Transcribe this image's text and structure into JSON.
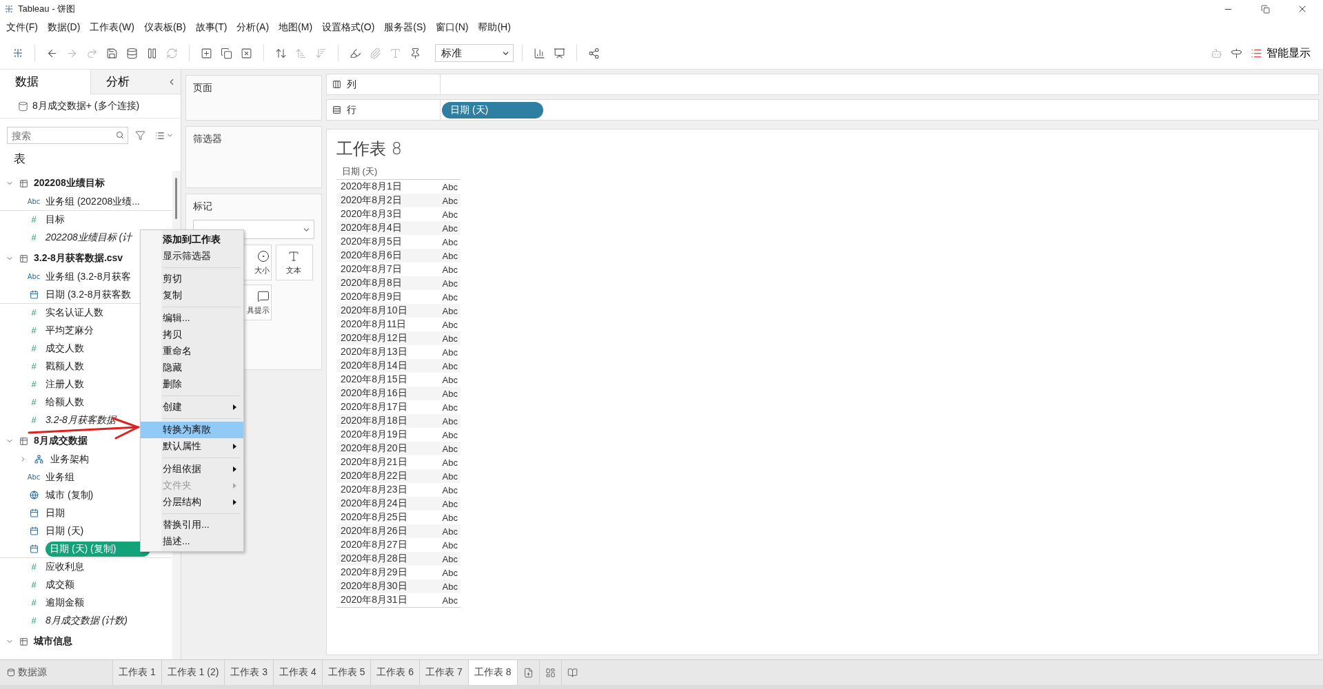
{
  "window": {
    "title": "Tableau - 饼图"
  },
  "menu_bar": [
    "文件(F)",
    "数据(D)",
    "工作表(W)",
    "仪表板(B)",
    "故事(T)",
    "分析(A)",
    "地图(M)",
    "设置格式(O)",
    "服务器(S)",
    "窗口(N)",
    "帮助(H)"
  ],
  "toolbar": {
    "fit": "标准",
    "show_me": "智能显示"
  },
  "data_pane": {
    "tabs": [
      {
        "label": "数据",
        "selected": true
      },
      {
        "label": "分析",
        "selected": false
      }
    ],
    "data_source": "8月成交数据+ (多个连接)",
    "search": {
      "placeholder": "搜索"
    },
    "section_title": "表",
    "tables": [
      {
        "name": "202208业绩目标",
        "expanded": true,
        "fields": [
          {
            "kind": "text",
            "icon": "Abc",
            "name": "业务组 (202208业绩...",
            "italic": false,
            "selected": false
          },
          {
            "kind": "number",
            "icon": "#",
            "name": "目标",
            "italic": false,
            "selected": false
          },
          {
            "kind": "number",
            "icon": "#",
            "name": "202208业绩目标 (计",
            "italic": true,
            "selected": false
          }
        ]
      },
      {
        "name": "3.2-8月获客数据.csv",
        "expanded": true,
        "fields": [
          {
            "kind": "text",
            "icon": "Abc",
            "name": "业务组 (3.2-8月获客",
            "italic": false,
            "selected": false
          },
          {
            "kind": "date",
            "name": "日期 (3.2-8月获客数",
            "italic": false,
            "selected": false
          },
          {
            "kind": "number",
            "icon": "#",
            "name": "实名认证人数",
            "italic": false,
            "selected": false
          },
          {
            "kind": "number",
            "icon": "#",
            "name": "平均芝麻分",
            "italic": false,
            "selected": false
          },
          {
            "kind": "number",
            "icon": "#",
            "name": "成交人数",
            "italic": false,
            "selected": false
          },
          {
            "kind": "number",
            "icon": "#",
            "name": "戳额人数",
            "italic": false,
            "selected": false
          },
          {
            "kind": "number",
            "icon": "#",
            "name": "注册人数",
            "italic": false,
            "selected": false
          },
          {
            "kind": "number",
            "icon": "#",
            "name": "给额人数",
            "italic": false,
            "selected": false
          },
          {
            "kind": "number",
            "icon": "#",
            "name": "3.2-8月获客数据",
            "italic": true,
            "selected": false
          }
        ]
      },
      {
        "name": "8月成交数据",
        "expanded": true,
        "fields": [
          {
            "kind": "hierarchy",
            "name": "业务架构",
            "italic": false,
            "selected": false,
            "expanded": false
          },
          {
            "kind": "text",
            "icon": "Abc",
            "name": "业务组",
            "italic": false,
            "selected": false
          },
          {
            "kind": "geo-calc",
            "name": "城市 (复制)",
            "italic": false,
            "selected": false
          },
          {
            "kind": "date",
            "name": "日期",
            "italic": false,
            "selected": false
          },
          {
            "kind": "date-calc",
            "name": "日期 (天)",
            "italic": false,
            "selected": false
          },
          {
            "kind": "date-calc",
            "name": "日期 (天) (复制)",
            "italic": false,
            "selected": true
          },
          {
            "kind": "number",
            "icon": "#",
            "name": "应收利息",
            "italic": false,
            "selected": false
          },
          {
            "kind": "number",
            "icon": "#",
            "name": "成交额",
            "italic": false,
            "selected": false
          },
          {
            "kind": "number",
            "icon": "#",
            "name": "逾期金额",
            "italic": false,
            "selected": false
          },
          {
            "kind": "number",
            "icon": "#",
            "name": "8月成交数据 (计数)",
            "italic": true,
            "selected": false
          }
        ]
      },
      {
        "name": "城市信息",
        "expanded": true
      }
    ]
  },
  "cards": {
    "pages": "页面",
    "filters": "筛选器",
    "marks": {
      "title": "标记",
      "buttons": [
        {
          "kind": "size",
          "label": "大小"
        },
        {
          "kind": "text",
          "label": "文本"
        },
        {
          "kind": "tooltip",
          "label": "具提示"
        }
      ]
    }
  },
  "shelves": {
    "columns": {
      "label": "列"
    },
    "rows": {
      "label": "行",
      "pills": [
        {
          "label": "日期 (天)"
        }
      ]
    }
  },
  "worksheet": {
    "title": "工作表 8",
    "header": "日期 (天)",
    "rows": [
      {
        "date": "2020年8月1日",
        "mark": "Abc"
      },
      {
        "date": "2020年8月2日",
        "mark": "Abc"
      },
      {
        "date": "2020年8月3日",
        "mark": "Abc"
      },
      {
        "date": "2020年8月4日",
        "mark": "Abc"
      },
      {
        "date": "2020年8月5日",
        "mark": "Abc"
      },
      {
        "date": "2020年8月6日",
        "mark": "Abc"
      },
      {
        "date": "2020年8月7日",
        "mark": "Abc"
      },
      {
        "date": "2020年8月8日",
        "mark": "Abc"
      },
      {
        "date": "2020年8月9日",
        "mark": "Abc"
      },
      {
        "date": "2020年8月10日",
        "mark": "Abc"
      },
      {
        "date": "2020年8月11日",
        "mark": "Abc"
      },
      {
        "date": "2020年8月12日",
        "mark": "Abc"
      },
      {
        "date": "2020年8月13日",
        "mark": "Abc"
      },
      {
        "date": "2020年8月14日",
        "mark": "Abc"
      },
      {
        "date": "2020年8月15日",
        "mark": "Abc"
      },
      {
        "date": "2020年8月16日",
        "mark": "Abc"
      },
      {
        "date": "2020年8月17日",
        "mark": "Abc"
      },
      {
        "date": "2020年8月18日",
        "mark": "Abc"
      },
      {
        "date": "2020年8月19日",
        "mark": "Abc"
      },
      {
        "date": "2020年8月20日",
        "mark": "Abc"
      },
      {
        "date": "2020年8月21日",
        "mark": "Abc"
      },
      {
        "date": "2020年8月22日",
        "mark": "Abc"
      },
      {
        "date": "2020年8月23日",
        "mark": "Abc"
      },
      {
        "date": "2020年8月24日",
        "mark": "Abc"
      },
      {
        "date": "2020年8月25日",
        "mark": "Abc"
      },
      {
        "date": "2020年8月26日",
        "mark": "Abc"
      },
      {
        "date": "2020年8月27日",
        "mark": "Abc"
      },
      {
        "date": "2020年8月28日",
        "mark": "Abc"
      },
      {
        "date": "2020年8月29日",
        "mark": "Abc"
      },
      {
        "date": "2020年8月30日",
        "mark": "Abc"
      },
      {
        "date": "2020年8月31日",
        "mark": "Abc"
      }
    ]
  },
  "context_menu": [
    {
      "kind": "item",
      "label": "添加到工作表",
      "default": true,
      "submenu": false,
      "disabled": false,
      "selected": false
    },
    {
      "kind": "item",
      "label": "显示筛选器",
      "default": false,
      "submenu": false,
      "disabled": false,
      "selected": false
    },
    {
      "kind": "separator"
    },
    {
      "kind": "item",
      "label": "剪切",
      "default": false,
      "submenu": false,
      "disabled": false,
      "selected": false
    },
    {
      "kind": "item",
      "label": "复制",
      "default": false,
      "submenu": false,
      "disabled": false,
      "selected": false
    },
    {
      "kind": "separator"
    },
    {
      "kind": "item",
      "label": "编辑...",
      "default": false,
      "submenu": false,
      "disabled": false,
      "selected": false
    },
    {
      "kind": "item",
      "label": "拷贝",
      "default": false,
      "submenu": false,
      "disabled": false,
      "selected": false
    },
    {
      "kind": "item",
      "label": "重命名",
      "default": false,
      "submenu": false,
      "disabled": false,
      "selected": false
    },
    {
      "kind": "item",
      "label": "隐藏",
      "default": false,
      "submenu": false,
      "disabled": false,
      "selected": false
    },
    {
      "kind": "item",
      "label": "删除",
      "default": false,
      "submenu": false,
      "disabled": false,
      "selected": false
    },
    {
      "kind": "separator"
    },
    {
      "kind": "item",
      "label": "创建",
      "default": false,
      "submenu": true,
      "disabled": false,
      "selected": false
    },
    {
      "kind": "separator"
    },
    {
      "kind": "item",
      "label": "转换为离散",
      "default": false,
      "submenu": false,
      "disabled": false,
      "selected": true
    },
    {
      "kind": "item",
      "label": "默认属性",
      "default": false,
      "submenu": true,
      "disabled": false,
      "selected": false
    },
    {
      "kind": "separator"
    },
    {
      "kind": "item",
      "label": "分组依据",
      "default": false,
      "submenu": true,
      "disabled": false,
      "selected": false
    },
    {
      "kind": "item",
      "label": "文件夹",
      "default": false,
      "submenu": true,
      "disabled": true,
      "selected": false
    },
    {
      "kind": "item",
      "label": "分层结构",
      "default": false,
      "submenu": true,
      "disabled": false,
      "selected": false
    },
    {
      "kind": "separator"
    },
    {
      "kind": "item",
      "label": "替换引用...",
      "default": false,
      "submenu": false,
      "disabled": false,
      "selected": false
    },
    {
      "kind": "item",
      "label": "描述...",
      "default": false,
      "submenu": false,
      "disabled": false,
      "selected": false
    }
  ],
  "sheet_tabs": {
    "data_source": "数据源",
    "tabs": [
      {
        "label": "工作表 1",
        "selected": false
      },
      {
        "label": "工作表 1 (2)",
        "selected": false
      },
      {
        "label": "工作表 3",
        "selected": false
      },
      {
        "label": "工作表 4",
        "selected": false
      },
      {
        "label": "工作表 5",
        "selected": false
      },
      {
        "label": "工作表 6",
        "selected": false
      },
      {
        "label": "工作表 7",
        "selected": false
      },
      {
        "label": "工作表 8",
        "selected": true
      }
    ]
  }
}
